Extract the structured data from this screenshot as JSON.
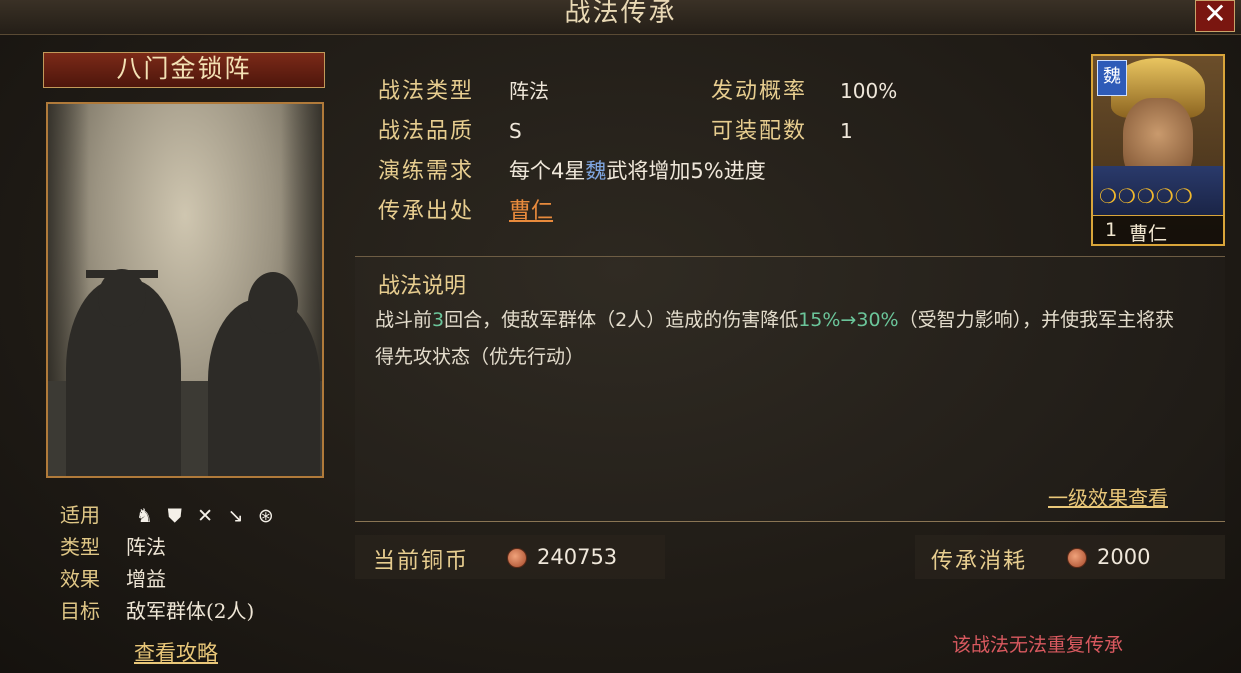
{
  "window": {
    "title": "战法传承",
    "close_glyph": "✕"
  },
  "skill": {
    "name": "八门金锁阵"
  },
  "left_info": {
    "apply_label": "适用",
    "apply_icons": [
      "cavalry-icon",
      "shield-icon",
      "archer-icon",
      "spear-icon",
      "vehicle-icon"
    ],
    "type_label": "类型",
    "type_value": "阵法",
    "effect_label": "效果",
    "effect_value": "增益",
    "target_label": "目标",
    "target_value": "敌军群体(2人)",
    "guide_link": "查看攻略"
  },
  "attrs": {
    "type_label": "战法类型",
    "type_value": "阵法",
    "rate_label": "发动概率",
    "rate_value": "100%",
    "quality_label": "战法品质",
    "quality_value": "S",
    "slots_label": "可装配数",
    "slots_value": "1",
    "train_label": "演练需求",
    "train_pre": "每个4星",
    "train_faction": "魏",
    "train_post": "武将增加5%进度",
    "source_label": "传承出处",
    "source_value": "曹仁"
  },
  "description": {
    "title": "战法说明",
    "part1": "战斗前",
    "rounds": "3",
    "part2": "回合，使敌军群体（2人）造成的伤害降低",
    "range": "15%→30%",
    "part3": "（受智力影响），并使我军主将获得先攻状态（优先行动）",
    "level_link": "一级效果查看"
  },
  "currency": {
    "current_label": "当前铜币",
    "current_value": "240753",
    "cost_label": "传承消耗",
    "cost_value": "2000"
  },
  "warning": "该战法无法重复传承",
  "hero": {
    "faction": "魏",
    "level": "1",
    "name": "曹仁",
    "stars": "❍❍❍❍❍",
    "star_count": 5
  }
}
